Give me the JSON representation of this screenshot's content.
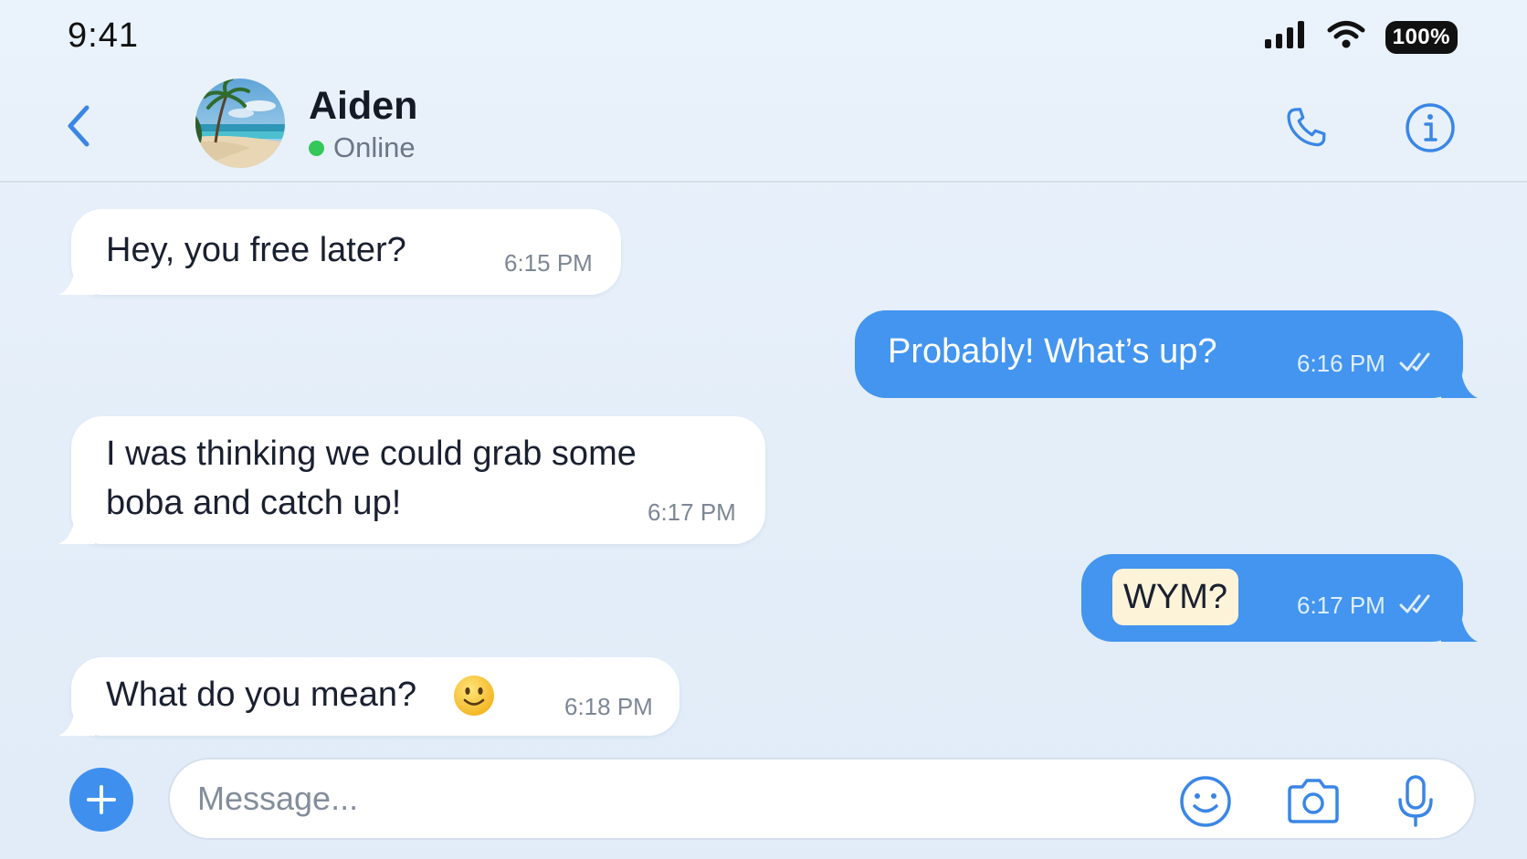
{
  "status_bar": {
    "time": "9:41",
    "battery": "100%",
    "icons": [
      "cellular-signal-icon",
      "wifi-icon",
      "battery-icon"
    ]
  },
  "header": {
    "back_icon": "chevron-left-icon",
    "contact_name": "Aiden",
    "presence": "Online",
    "presence_color": "#34c759",
    "call_icon": "phone-icon",
    "info_icon": "info-icon"
  },
  "messages": [
    {
      "direction": "incoming",
      "text": "Hey, you free later?",
      "time": "6:15 PM"
    },
    {
      "direction": "outgoing",
      "text": "Probably! What’s up?",
      "time": "6:16 PM",
      "status": "read"
    },
    {
      "direction": "incoming",
      "text_line1": "I was thinking we could grab some",
      "text_line2": "boba and catch up!",
      "time": "6:17 PM"
    },
    {
      "direction": "outgoing",
      "text": "WYM?",
      "time": "6:17 PM",
      "status": "read",
      "highlighted": true
    },
    {
      "direction": "incoming",
      "text": "What do you mean?",
      "emoji": "🙂",
      "time": "6:18 PM"
    }
  ],
  "composer": {
    "placeholder": "Message...",
    "icons": [
      "plus-icon",
      "emoji-icon",
      "camera-icon",
      "microphone-icon"
    ]
  },
  "colors": {
    "accent": "#4395ef",
    "incoming_bubble": "#ffffff",
    "highlight": "#fdf3d9"
  }
}
